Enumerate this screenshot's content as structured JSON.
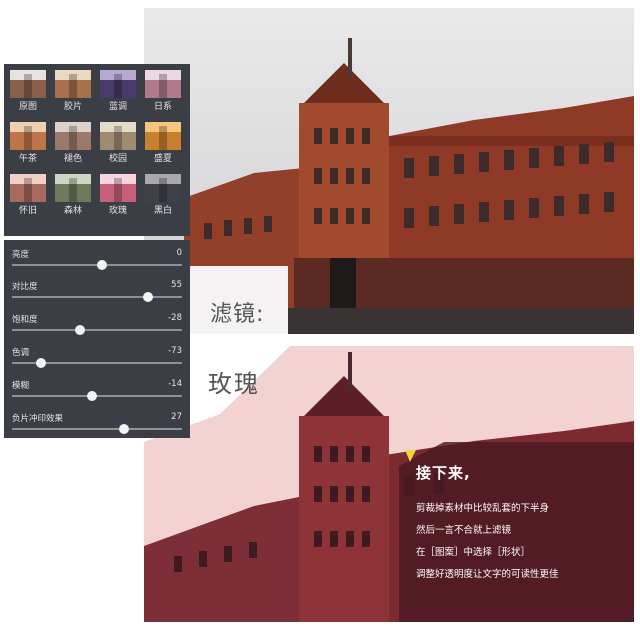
{
  "filter_grid": [
    {
      "label": "原图",
      "tint": "#8a5f4c"
    },
    {
      "label": "胶片",
      "tint": "#a8704a"
    },
    {
      "label": "蓝调",
      "tint": "#4a3a6a"
    },
    {
      "label": "日系",
      "tint": "#b07a8c"
    },
    {
      "label": "午茶",
      "tint": "#c07548"
    },
    {
      "label": "褪色",
      "tint": "#9a7a6a"
    },
    {
      "label": "校园",
      "tint": "#a08a70"
    },
    {
      "label": "盛夏",
      "tint": "#c8802e"
    },
    {
      "label": "怀旧",
      "tint": "#a86a5e"
    },
    {
      "label": "森林",
      "tint": "#6c7a5a"
    },
    {
      "label": "玫瑰",
      "tint": "#c8607a"
    },
    {
      "label": "黑白",
      "tint": "#404048"
    }
  ],
  "adjustments": [
    {
      "label": "亮度",
      "value": "0",
      "level": 0.53
    },
    {
      "label": "对比度",
      "value": "55",
      "level": 0.8
    },
    {
      "label": "饱和度",
      "value": "-28",
      "level": 0.4
    },
    {
      "label": "色调",
      "value": "-73",
      "level": 0.17
    },
    {
      "label": "模糊",
      "value": "-14",
      "level": 0.47
    },
    {
      "label": "负片冲印效果",
      "value": "27",
      "level": 0.66
    }
  ],
  "headings": {
    "label_title": "滤镜:",
    "filter_name": "玫瑰"
  },
  "overlay": {
    "heading": "接下来,",
    "lines": [
      "剪裁掉素材中比较乱套的下半身",
      "然后一言不合就上滤镜",
      "在［图案］中选择［形状］",
      "调整好透明度让文字的可读性更佳"
    ]
  },
  "colors": {
    "panel_bg": "#3b3e45",
    "rose_tint": "#c83c5a",
    "accent_yellow": "#f2d23a"
  }
}
